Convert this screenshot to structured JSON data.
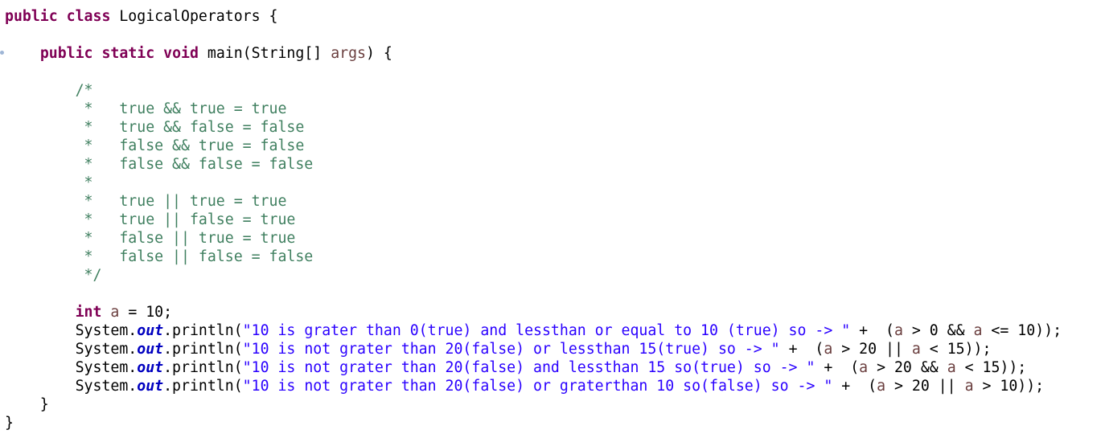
{
  "editor": {
    "language": "Java",
    "lines": [
      "public class LogicalOperators {",
      "",
      "    public static void main(String[] args) {",
      "",
      "        /*",
      "         *   true && true = true",
      "         *   true && false = false",
      "         *   false && true = false",
      "         *   false && false = false",
      "         *",
      "         *   true || true = true",
      "         *   true || false = true",
      "         *   false || true = true",
      "         *   false || false = false",
      "         */",
      "",
      "        int a = 10;",
      "        System.out.println(\"10 is grater than 0(true) and lessthan or equal to 10 (true) so -> \" +  (a > 0 && a <= 10));",
      "        System.out.println(\"10 is not grater than 20(false) or lessthan 15(true) so -> \" +  (a > 20 || a < 15));",
      "        System.out.println(\"10 is not grater than 20(false) and lessthan 15 so(true) so -> \" +  (a > 20 && a < 15));",
      "        System.out.println(\"10 is not grater than 20(false) or graterthan 10 so(false) so -> \" +  (a > 20 || a > 10));",
      "    }",
      "}"
    ]
  },
  "syntax_colors": {
    "keyword": "#7f0055",
    "comment": "#3f7f5f",
    "string": "#2a00ff",
    "local_variable": "#6a3e3e",
    "static_field": "#0000c0",
    "default": "#000000",
    "background": "#ffffff"
  }
}
